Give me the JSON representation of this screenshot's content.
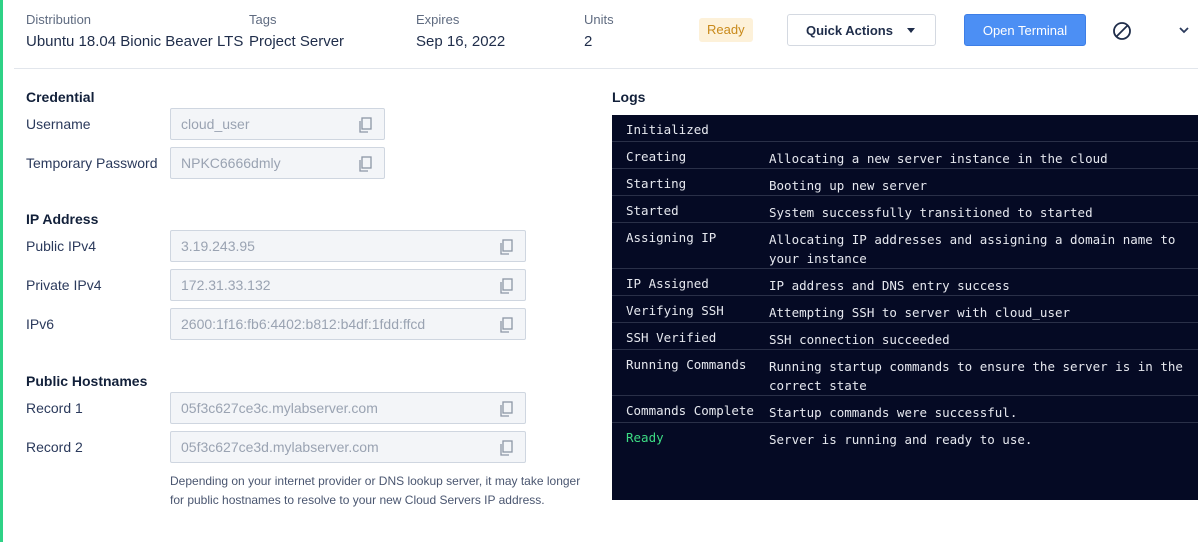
{
  "header": {
    "distribution": {
      "label": "Distribution",
      "value": "Ubuntu 18.04 Bionic Beaver LTS"
    },
    "tags": {
      "label": "Tags",
      "value": "Project Server"
    },
    "expires": {
      "label": "Expires",
      "value": "Sep 16, 2022"
    },
    "units": {
      "label": "Units",
      "value": "2"
    },
    "status_badge": "Ready",
    "quick_actions_label": "Quick Actions",
    "open_terminal_label": "Open Terminal",
    "disable_icon": "block-icon",
    "expand_icon": "chevron-down-icon"
  },
  "credential": {
    "title": "Credential",
    "username": {
      "label": "Username",
      "value": "cloud_user"
    },
    "password": {
      "label": "Temporary Password",
      "value": "NPKC6666dmly"
    }
  },
  "ip_address": {
    "title": "IP Address",
    "public_ipv4": {
      "label": "Public IPv4",
      "value": "3.19.243.95"
    },
    "private_ipv4": {
      "label": "Private IPv4",
      "value": "172.31.33.132"
    },
    "ipv6": {
      "label": "IPv6",
      "value": "2600:1f16:fb6:4402:b812:b4df:1fdd:ffcd"
    }
  },
  "hostnames": {
    "title": "Public Hostnames",
    "record1": {
      "label": "Record 1",
      "value": "05f3c627ce3c.mylabserver.com"
    },
    "record2": {
      "label": "Record 2",
      "value": "05f3c627ce3d.mylabserver.com"
    },
    "note": "Depending on your internet provider or DNS lookup server, it may take longer for public hostnames to resolve to your new Cloud Servers IP address."
  },
  "logs": {
    "title": "Logs",
    "entries": [
      {
        "status": "Initialized",
        "message": ""
      },
      {
        "status": "Creating",
        "message": "Allocating a new server instance in the cloud"
      },
      {
        "status": "Starting",
        "message": "Booting up new server"
      },
      {
        "status": "Started",
        "message": "System successfully transitioned to started"
      },
      {
        "status": "Assigning IP",
        "message": "Allocating IP addresses and assigning a domain name to your instance"
      },
      {
        "status": "IP Assigned",
        "message": "IP address and DNS entry success"
      },
      {
        "status": "Verifying SSH",
        "message": "Attempting SSH to server with cloud_user"
      },
      {
        "status": "SSH Verified",
        "message": "SSH connection succeeded"
      },
      {
        "status": "Running Commands",
        "message": "Running startup commands to ensure the server is in the correct state"
      },
      {
        "status": "Commands Complete",
        "message": "Startup commands were successful."
      },
      {
        "status": "Ready",
        "message": "Server is running and ready to use."
      }
    ]
  },
  "colors": {
    "accent_green": "#2fd286",
    "primary_blue": "#4c8ff4",
    "ready_badge_bg": "#fdf1d9",
    "ready_badge_text": "#c98a1b",
    "logs_bg": "#050a24",
    "log_ready_green": "#3ddc84"
  }
}
